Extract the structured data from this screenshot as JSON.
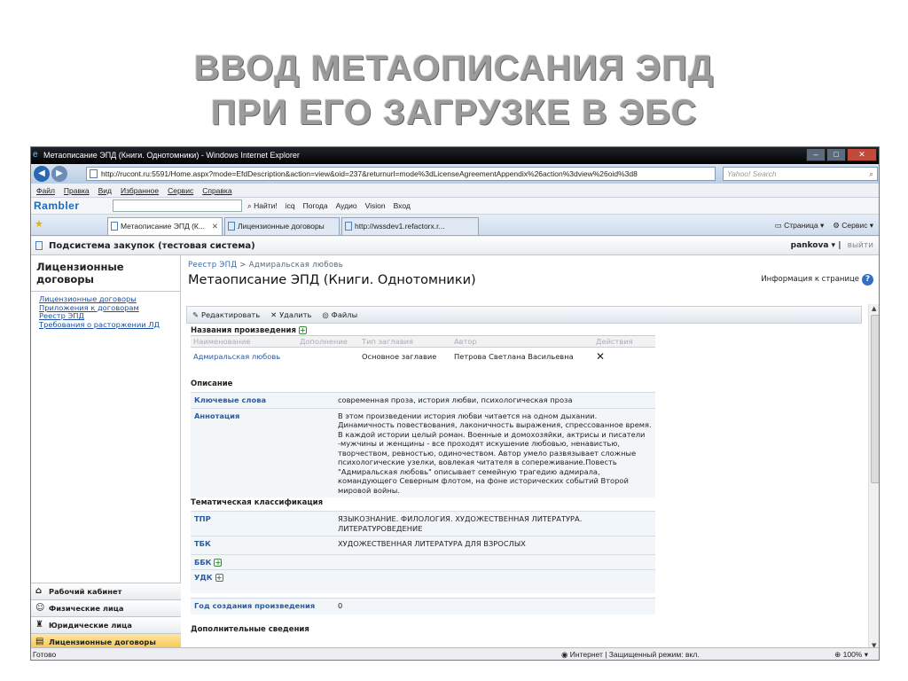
{
  "slide": {
    "title_line1": "ВВОД МЕТАОПИСАНИЯ ЭПД",
    "title_line2": "ПРИ ЕГО ЗАГРУЗКЕ В ЭБС"
  },
  "window": {
    "title": "Метаописание ЭПД (Книги. Однотомники) - Windows Internet Explorer"
  },
  "address": {
    "url": "http://rucont.ru:5591/Home.aspx?mode=EfdDescription&action=view&oid=237&returnurl=mode%3dLicenseAgreementAppendix%26action%3dview%26oid%3d8",
    "search_placeholder": "Yahoo! Search"
  },
  "menu": [
    "Файл",
    "Правка",
    "Вид",
    "Избранное",
    "Сервис",
    "Справка"
  ],
  "rambler": {
    "logo": "Rambler",
    "items": [
      "Найти!",
      "icq",
      "Погода",
      "Аудио",
      "Vision",
      "Вход"
    ]
  },
  "tabs": [
    {
      "label": "Метаописание ЭПД (К...",
      "active": true
    },
    {
      "label": "Лицензионные договоры",
      "active": false
    },
    {
      "label": "http://wssdev1.refactorx.r...",
      "active": false
    }
  ],
  "tab_tools": [
    "Страница",
    "Сервис"
  ],
  "system": {
    "title": "Подсистема закупок (тестовая система)",
    "user": "pankova",
    "logout": "выйти"
  },
  "left_nav": {
    "heading": "Лицензионные договоры",
    "links": [
      "Лицензионные договоры",
      "Приложения к договорам",
      "Реестр ЭПД",
      "Требования о расторжении ЛД"
    ],
    "bottom": [
      {
        "label": "Рабочий кабинет",
        "icon": "home-icon"
      },
      {
        "label": "Физические лица",
        "icon": "person-icon"
      },
      {
        "label": "Юридические лица",
        "icon": "org-icon"
      },
      {
        "label": "Лицензионные договоры",
        "icon": "contract-icon",
        "active": true
      }
    ]
  },
  "breadcrumb": {
    "root": "Реестр ЭПД",
    "sep": ">",
    "current": "Адмиральская любовь"
  },
  "page": {
    "title": "Метаописание ЭПД (Книги. Однотомники)",
    "info": "Информация к странице"
  },
  "toolbar": {
    "edit": "Редактировать",
    "delete": "Удалить",
    "files": "Файлы"
  },
  "names_section": {
    "title": "Названия произведения",
    "columns": [
      "Наименование",
      "Дополнение",
      "Тип заглавия",
      "Автор",
      "Действия"
    ],
    "rows": [
      {
        "name": "Адмиральская любовь",
        "addition": "",
        "type": "Основное заглавие",
        "author": "Петрова Светлана Васильевна"
      }
    ]
  },
  "description": {
    "title": "Описание",
    "keywords_label": "Ключевые слова",
    "keywords": "современная проза, история любви, психологическая проза",
    "annotation_label": "Аннотация",
    "annotation": "В этом произведении история любви читается на одном дыхании. Динамичность повествования, лаконичность выражения, спрессованное время. В каждой истории целый роман. Военные и домохозяйки, актрисы и писатели -мужчины и женщины - все проходят искушение любовью, ненавистью, творчеством, ревностью, одиночеством. Автор умело развязывает сложные психологические узелки, вовлекая читателя в сопереживание.Повесть \"Адмиральская любовь\" описывает семейную трагедию адмирала, командующего Северным флотом, на фоне исторических событий Второй мировой войны."
  },
  "classification": {
    "title": "Тематическая классификация",
    "tpr_label": "ТПР",
    "tpr": "ЯЗЫКОЗНАНИЕ. ФИЛОЛОГИЯ. ХУДОЖЕСТВЕННАЯ ЛИТЕРАТУРА. ЛИТЕРАТУРОВЕДЕНИЕ",
    "tbk_label": "ТБК",
    "tbk": "ХУДОЖЕСТВЕННАЯ ЛИТЕРАТУРА ДЛЯ ВЗРОСЛЫХ",
    "bbk_label": "ББК",
    "udk_label": "УДК"
  },
  "year": {
    "label": "Год создания произведения",
    "value": "0"
  },
  "extra": {
    "title": "Дополнительные сведения"
  },
  "status": {
    "ready": "Готово",
    "zone": "Интернет | Защищенный режим: вкл.",
    "zoom": "100%"
  }
}
